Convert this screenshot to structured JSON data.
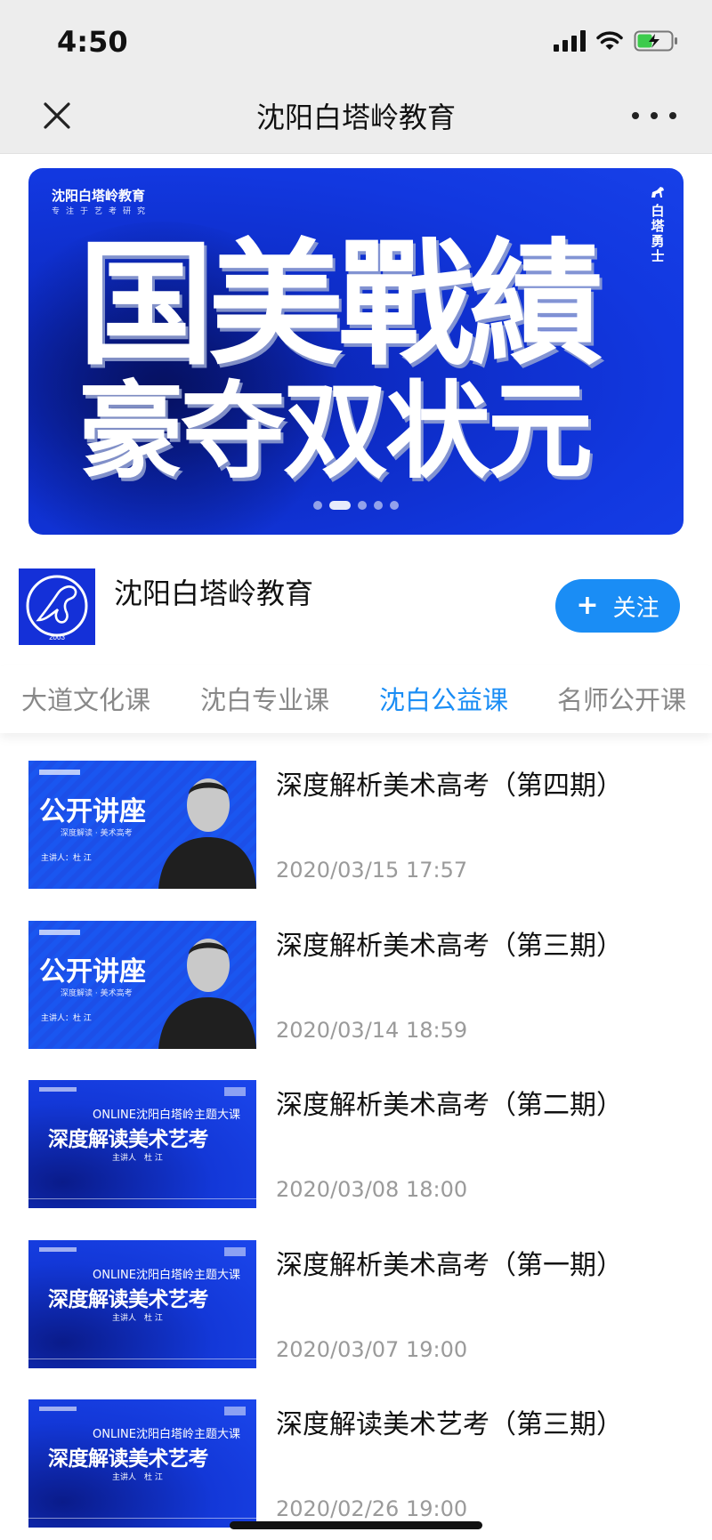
{
  "status_bar": {
    "time": "4:50"
  },
  "nav": {
    "title": "沈阳白塔岭教育"
  },
  "banner": {
    "brand": "沈阳白塔岭教育",
    "brand_sub": "专注于艺考研究",
    "side_text": "白塔勇士",
    "headline_1": "国美戰績",
    "headline_2": "豪夺双状元",
    "slides": 5,
    "active_slide": 2
  },
  "profile": {
    "name": "沈阳白塔岭教育",
    "avatar_caption": "2003",
    "follow_label": "关注"
  },
  "tabs": [
    {
      "label": "大道文化课",
      "active": false
    },
    {
      "label": "沈白专业课",
      "active": false
    },
    {
      "label": "沈白公益课",
      "active": true
    },
    {
      "label": "名师公开课",
      "active": false
    }
  ],
  "articles": [
    {
      "title": "深度解析美术高考（第四期）",
      "date": "2020/03/15 17:57",
      "thumb": {
        "style": "lecture",
        "headline": "公开讲座",
        "sub": "深度解读 · 美术高考",
        "speaker": "主讲人：杜 江"
      }
    },
    {
      "title": "深度解析美术高考（第三期）",
      "date": "2020/03/14 18:59",
      "thumb": {
        "style": "lecture",
        "headline": "公开讲座",
        "sub": "深度解读 · 美术高考",
        "speaker": "主讲人：杜 江"
      }
    },
    {
      "title": "深度解析美术高考（第二期）",
      "date": "2020/03/08 18:00",
      "thumb": {
        "style": "online",
        "header": "ONLINE沈阳白塔岭主题大课",
        "headline": "深度解读美术艺考",
        "speaker": "主讲人　杜 江"
      }
    },
    {
      "title": "深度解析美术高考（第一期）",
      "date": "2020/03/07 19:00",
      "thumb": {
        "style": "online",
        "header": "ONLINE沈阳白塔岭主题大课",
        "headline": "深度解读美术艺考",
        "speaker": "主讲人　杜 江"
      }
    },
    {
      "title": "深度解读美术艺考（第三期）",
      "date": "2020/02/26 19:00",
      "thumb": {
        "style": "online",
        "header": "ONLINE沈阳白塔岭主题大课",
        "headline": "深度解读美术艺考",
        "speaker": "主讲人　杜 江"
      }
    }
  ],
  "colors": {
    "accent": "#1a8df5",
    "banner_blue": "#1238e0",
    "nav_bg": "#ededed"
  }
}
